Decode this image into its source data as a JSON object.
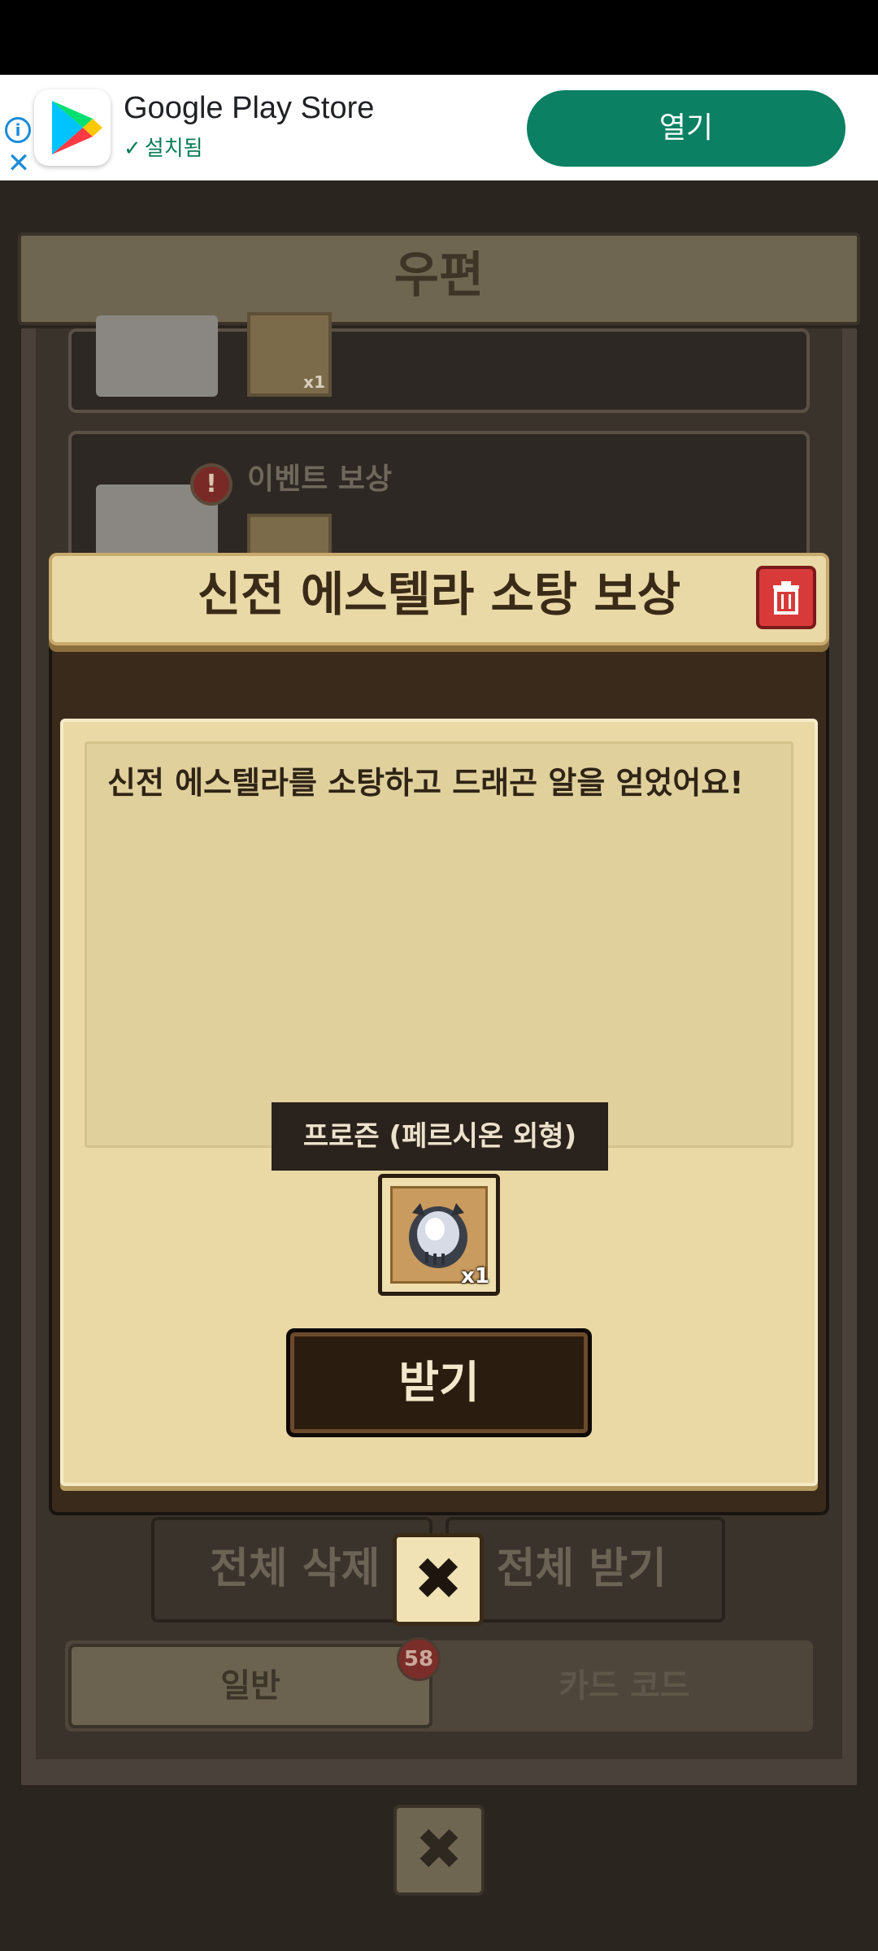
{
  "ad": {
    "info_icon": "info-icon",
    "close_icon": "close-icon",
    "app_name": "Google Play Store",
    "status": "설치됨",
    "open_label": "열기"
  },
  "mailbox": {
    "title": "우편",
    "items": [
      {
        "label": "",
        "qty": "x1"
      },
      {
        "label": "이벤트 보상",
        "badge": "!"
      }
    ],
    "delete_all": "전체 삭제",
    "receive_all": "전체 받기",
    "tabs": {
      "normal": "일반",
      "normal_count": "58",
      "card_code": "카드 코드"
    }
  },
  "modal": {
    "title": "신전 에스텔라 소탕 보상",
    "message": "신전 에스텔라를 소탕하고 드래곤 알을 얻었어요!",
    "item_tooltip": "프로즌 (페르시온 외형)",
    "item_qty": "x1",
    "receive_label": "받기"
  },
  "colors": {
    "play_green": "#0b8062",
    "modal_cream": "#ead9a4",
    "delete_red": "#d83a3a"
  }
}
